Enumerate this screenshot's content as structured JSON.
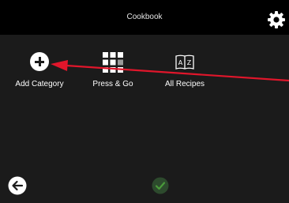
{
  "header": {
    "title": "Cookbook",
    "settings_icon": "gear-icon"
  },
  "menu": [
    {
      "label": "Add Category",
      "icon": "plus-circle-icon"
    },
    {
      "label": "Press & Go",
      "icon": "grid-icon"
    },
    {
      "label": "All Recipes",
      "icon": "a-z-book-icon"
    }
  ],
  "footer": {
    "back_icon": "arrow-left-icon",
    "confirm_icon": "checkmark-icon"
  },
  "annotation": {
    "arrow_color": "#e0162b",
    "points_to": "Add Category"
  },
  "colors": {
    "background": "#1b1b1b",
    "header": "#000000",
    "text": "#ffffff",
    "confirm_fill": "#2d4a2d",
    "confirm_check": "#4a9a3a"
  }
}
